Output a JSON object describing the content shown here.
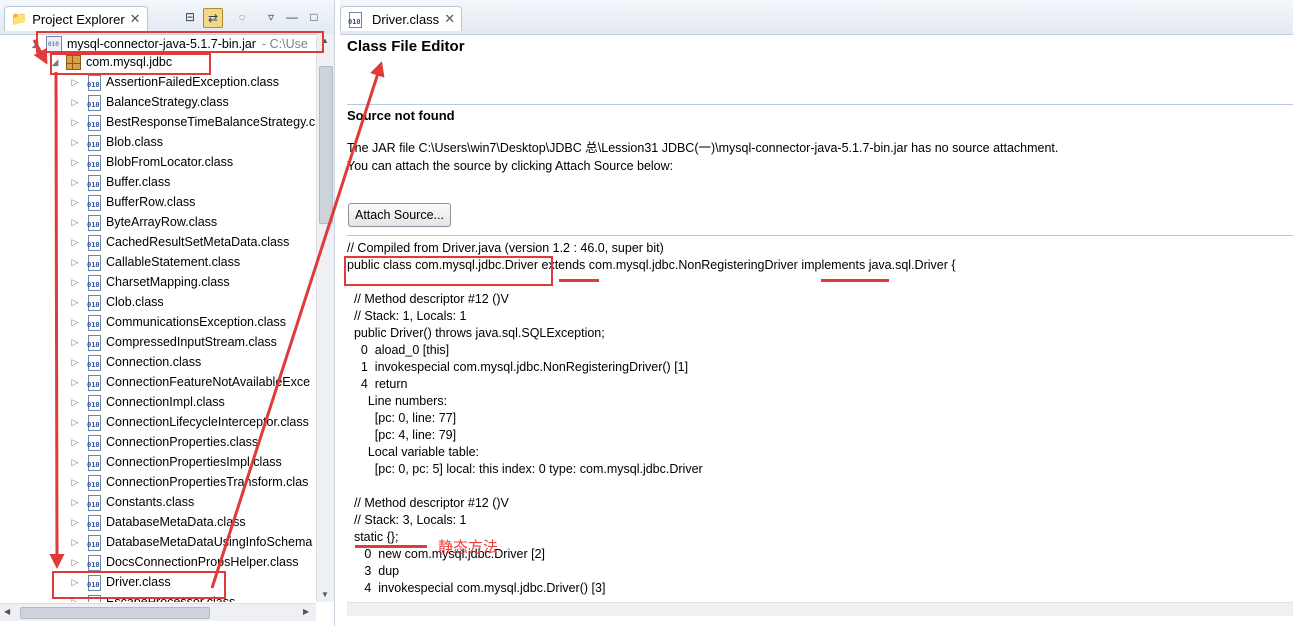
{
  "left_panel": {
    "tab_title": "Project Explorer",
    "tree": {
      "jar": {
        "name": "mysql-connector-java-5.1.7-bin.jar",
        "path": "- C:\\Use"
      },
      "package": "com.mysql.jdbc",
      "classes": [
        "AssertionFailedException.class",
        "BalanceStrategy.class",
        "BestResponseTimeBalanceStrategy.c",
        "Blob.class",
        "BlobFromLocator.class",
        "Buffer.class",
        "BufferRow.class",
        "ByteArrayRow.class",
        "CachedResultSetMetaData.class",
        "CallableStatement.class",
        "CharsetMapping.class",
        "Clob.class",
        "CommunicationsException.class",
        "CompressedInputStream.class",
        "Connection.class",
        "ConnectionFeatureNotAvailableExce",
        "ConnectionImpl.class",
        "ConnectionLifecycleInterceptor.class",
        "ConnectionProperties.class",
        "ConnectionPropertiesImpl.class",
        "ConnectionPropertiesTransform.clas",
        "Constants.class",
        "DatabaseMetaData.class",
        "DatabaseMetaDataUsingInfoSchema",
        "DocsConnectionPropsHelper.class",
        "Driver.class",
        "EscapeProcessor.class"
      ]
    }
  },
  "right_panel": {
    "tab_title": "Driver.class",
    "editor_title": "Class File Editor",
    "source_title": "Source not found",
    "message1": "The JAR file C:\\Users\\win7\\Desktop\\JDBC 总\\Lession31 JDBC(一)\\mysql-connector-java-5.1.7-bin.jar has no source attachment.",
    "message2": "You can attach the source by clicking Attach Source below:",
    "attach_button": "Attach Source...",
    "code_lines": [
      "// Compiled from Driver.java (version 1.2 : 46.0, super bit)",
      "public class com.mysql.jdbc.Driver extends com.mysql.jdbc.NonRegisteringDriver implements java.sql.Driver {",
      "",
      "  // Method descriptor #12 ()V",
      "  // Stack: 1, Locals: 1",
      "  public Driver() throws java.sql.SQLException;",
      "    0  aload_0 [this]",
      "    1  invokespecial com.mysql.jdbc.NonRegisteringDriver() [1]",
      "    4  return",
      "      Line numbers:",
      "        [pc: 0, line: 77]",
      "        [pc: 4, line: 79]",
      "      Local variable table:",
      "        [pc: 0, pc: 5] local: this index: 0 type: com.mysql.jdbc.Driver",
      "",
      "  // Method descriptor #12 ()V",
      "  // Stack: 3, Locals: 1",
      "  static {};",
      "     0  new com.mysql.jdbc.Driver [2]",
      "     3  dup",
      "     4  invokespecial com.mysql.jdbc.Driver() [3]"
    ]
  },
  "annotation": {
    "static_note": "静态方法",
    "color": "#e03a3a"
  }
}
